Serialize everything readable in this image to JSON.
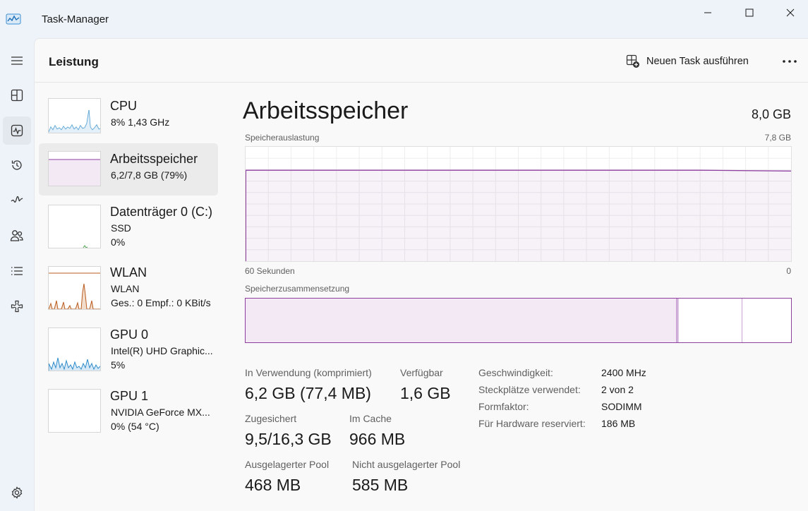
{
  "window": {
    "title": "Task-Manager",
    "app_icon": "task-manager-icon",
    "controls": [
      "minimize-icon",
      "maximize-icon",
      "close-icon"
    ]
  },
  "rail": {
    "items": [
      {
        "icon": "hamburger-menu-icon"
      },
      {
        "icon": "processes-icon"
      },
      {
        "icon": "performance-icon",
        "active": true
      },
      {
        "icon": "app-history-icon"
      },
      {
        "icon": "startup-apps-icon"
      },
      {
        "icon": "users-icon"
      },
      {
        "icon": "details-icon"
      },
      {
        "icon": "services-icon"
      },
      {
        "icon": "settings-icon"
      }
    ]
  },
  "header": {
    "title": "Leistung",
    "run_task_label": "Neuen Task ausführen",
    "run_task_icon": "new-task-icon",
    "more_icon": "more-options-icon"
  },
  "sidebar": {
    "items": [
      {
        "name": "CPU",
        "lines": [
          "8%  1,43 GHz"
        ],
        "color": "#2e8bc9"
      },
      {
        "name": "Arbeitsspeicher",
        "lines": [
          "6,2/7,8 GB (79%)"
        ],
        "color": "#8e3fa0",
        "selected": true
      },
      {
        "name": "Datenträger 0 (C:)",
        "lines": [
          "SSD",
          "0%"
        ],
        "color": "#4ca64c"
      },
      {
        "name": "WLAN",
        "lines": [
          "WLAN",
          "Ges.: 0  Empf.: 0 KBit/s"
        ],
        "color": "#b85c1e"
      },
      {
        "name": "GPU 0",
        "lines": [
          "Intel(R) UHD Graphic...",
          "5%"
        ],
        "color": "#2e8bc9"
      },
      {
        "name": "GPU 1",
        "lines": [
          "NVIDIA GeForce MX...",
          "0%  (54 °C)"
        ],
        "color": "#2e8bc9"
      }
    ]
  },
  "detail": {
    "title": "Arbeitsspeicher",
    "total": "8,0 GB",
    "usage_label": "Speicherauslastung",
    "usage_max": "7,8 GB",
    "x_left": "60 Sekunden",
    "x_right": "0",
    "composition_label": "Speicherzusammensetzung",
    "stats": {
      "in_use_label": "In Verwendung (komprimiert)",
      "in_use_value": "6,2 GB (77,4 MB)",
      "available_label": "Verfügbar",
      "available_value": "1,6 GB",
      "committed_label": "Zugesichert",
      "committed_value": "9,5/16,3 GB",
      "cached_label": "Im Cache",
      "cached_value": "966 MB",
      "paged_label": "Ausgelagerter Pool",
      "paged_value": "468 MB",
      "nonpaged_label": "Nicht ausgelagerter Pool",
      "nonpaged_value": "585 MB"
    },
    "properties": [
      {
        "label": "Geschwindigkeit:",
        "value": "2400 MHz"
      },
      {
        "label": "Steckplätze verwendet:",
        "value": "2 von 2"
      },
      {
        "label": "Formfaktor:",
        "value": "SODIMM"
      },
      {
        "label": "Für Hardware reserviert:",
        "value": "186 MB"
      }
    ]
  },
  "chart_data": {
    "type": "area",
    "ylabel": "Speicherauslastung",
    "ylim": [
      0,
      7.8
    ],
    "x": [
      60,
      50,
      40,
      30,
      20,
      10,
      0
    ],
    "series": [
      {
        "values": [
          6.2,
          6.2,
          6.2,
          6.2,
          6.2,
          6.2,
          6.15
        ]
      }
    ],
    "color": "#8e3fa0",
    "composition": {
      "in_use_fraction": 0.79,
      "modified_fraction": 0.003,
      "standby_fraction": 0.117,
      "free_fraction": 0.09
    }
  }
}
